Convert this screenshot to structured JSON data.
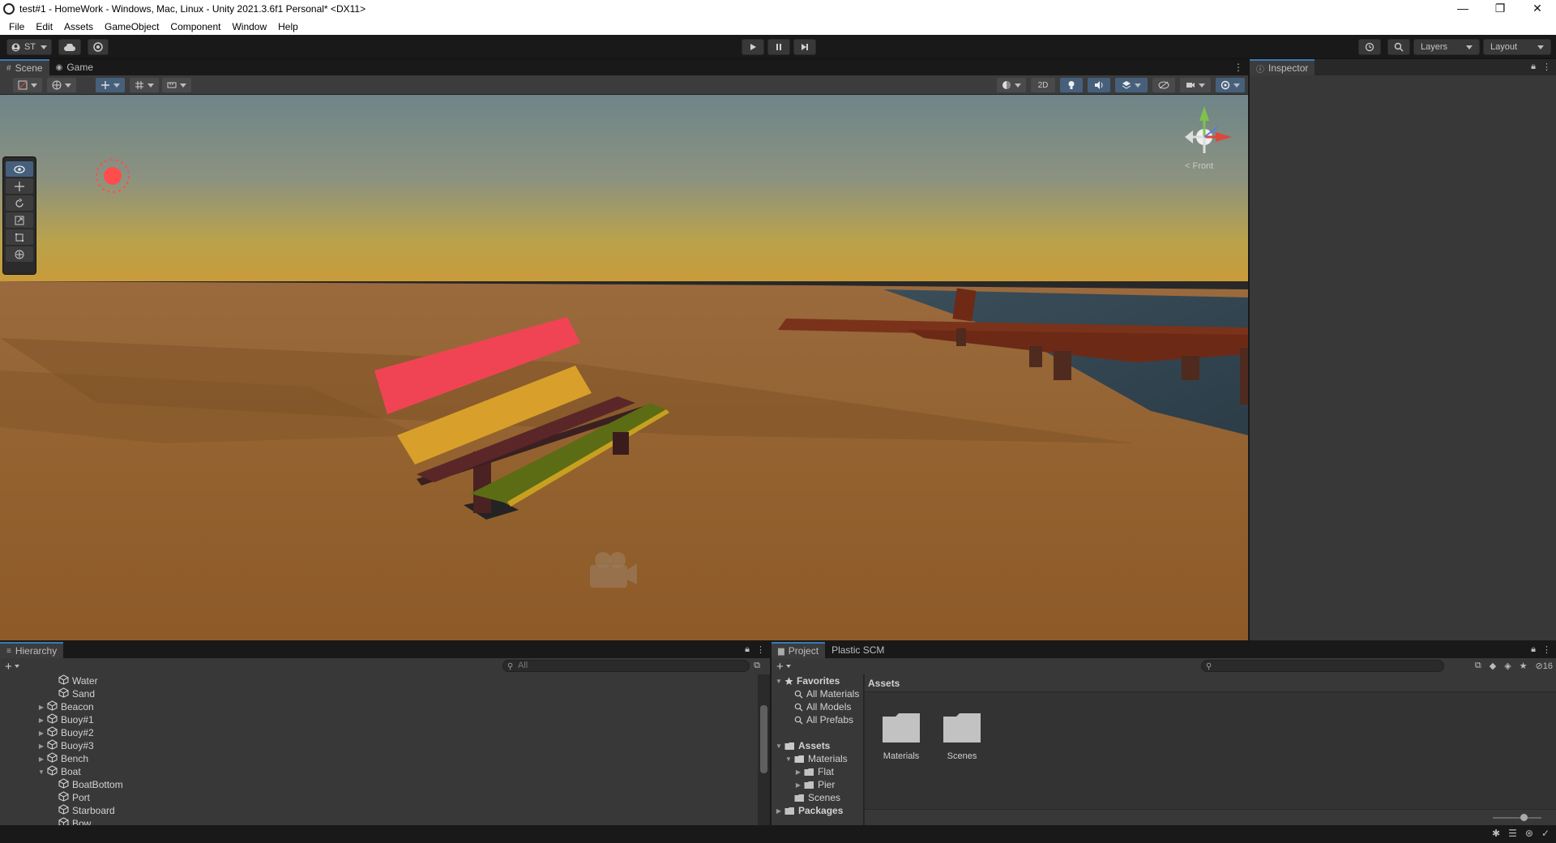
{
  "window": {
    "title": "test#1 - HomeWork - Windows, Mac, Linux - Unity 2021.3.6f1 Personal* <DX11>",
    "minimize": "—",
    "maximize": "❐",
    "close": "✕"
  },
  "menu": [
    "File",
    "Edit",
    "Assets",
    "GameObject",
    "Component",
    "Window",
    "Help"
  ],
  "toolbar": {
    "account_label": "ST",
    "layers_label": "Layers",
    "layout_label": "Layout"
  },
  "scene_panel": {
    "tabs": [
      {
        "label": "Scene",
        "icon": "grid-icon"
      },
      {
        "label": "Game",
        "icon": "gamepad-icon"
      }
    ],
    "mode_2d_label": "2D",
    "gizmo_view_label": "Front"
  },
  "inspector": {
    "tab_label": "Inspector"
  },
  "hierarchy": {
    "tab_label": "Hierarchy",
    "search_placeholder": "All",
    "items": [
      {
        "label": "Water",
        "depth": 1,
        "expandable": false
      },
      {
        "label": "Sand",
        "depth": 1,
        "expandable": false
      },
      {
        "label": "Beacon",
        "depth": 0,
        "expandable": true,
        "expanded": false
      },
      {
        "label": "Buoy#1",
        "depth": 0,
        "expandable": true,
        "expanded": false
      },
      {
        "label": "Buoy#2",
        "depth": 0,
        "expandable": true,
        "expanded": false
      },
      {
        "label": "Buoy#3",
        "depth": 0,
        "expandable": true,
        "expanded": false
      },
      {
        "label": "Bench",
        "depth": 0,
        "expandable": true,
        "expanded": false
      },
      {
        "label": "Boat",
        "depth": 0,
        "expandable": true,
        "expanded": true
      },
      {
        "label": "BoatBottom",
        "depth": 1,
        "expandable": false
      },
      {
        "label": "Port",
        "depth": 1,
        "expandable": false
      },
      {
        "label": "Starboard",
        "depth": 1,
        "expandable": false
      },
      {
        "label": "Bow",
        "depth": 1,
        "expandable": false
      }
    ]
  },
  "project": {
    "tabs": [
      "Project",
      "Plastic SCM"
    ],
    "hidden_count": "16",
    "breadcrumb": "Assets",
    "tree": [
      {
        "label": "Favorites",
        "depth": 0,
        "bold": true,
        "arrow": "▼",
        "icon": "star"
      },
      {
        "label": "All Materials",
        "depth": 1,
        "bold": false,
        "arrow": "",
        "icon": "search"
      },
      {
        "label": "All Models",
        "depth": 1,
        "bold": false,
        "arrow": "",
        "icon": "search"
      },
      {
        "label": "All Prefabs",
        "depth": 1,
        "bold": false,
        "arrow": "",
        "icon": "search"
      },
      {
        "label": "",
        "depth": 0,
        "bold": false,
        "arrow": "",
        "icon": ""
      },
      {
        "label": "Assets",
        "depth": 0,
        "bold": true,
        "arrow": "▼",
        "icon": "folder-open"
      },
      {
        "label": "Materials",
        "depth": 1,
        "bold": false,
        "arrow": "▼",
        "icon": "folder-open"
      },
      {
        "label": "Flat",
        "depth": 2,
        "bold": false,
        "arrow": "▶",
        "icon": "folder"
      },
      {
        "label": "Pier",
        "depth": 2,
        "bold": false,
        "arrow": "▶",
        "icon": "folder"
      },
      {
        "label": "Scenes",
        "depth": 1,
        "bold": false,
        "arrow": "",
        "icon": "folder"
      },
      {
        "label": "Packages",
        "depth": 0,
        "bold": true,
        "arrow": "▶",
        "icon": "folder"
      }
    ],
    "assets": [
      "Materials",
      "Scenes"
    ]
  }
}
